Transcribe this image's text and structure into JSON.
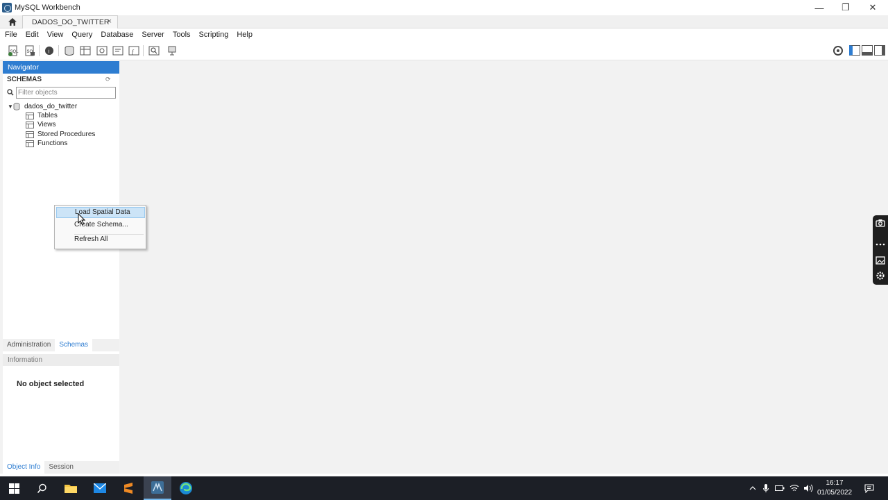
{
  "window": {
    "title": "MySQL Workbench",
    "minimize_glyph": "—",
    "maximize_glyph": "❐",
    "close_glyph": "✕"
  },
  "tabs": {
    "connection_tab_label": "DADOS_DO_TWITTER",
    "close_glyph": "×"
  },
  "menu": [
    "File",
    "Edit",
    "View",
    "Query",
    "Database",
    "Server",
    "Tools",
    "Scripting",
    "Help"
  ],
  "navigator": {
    "header": "Navigator",
    "schemas_label": "SCHEMAS",
    "filter_placeholder": "Filter objects",
    "schema_name": "dados_do_twitter",
    "expand_glyph": "▼",
    "children": [
      "Tables",
      "Views",
      "Stored Procedures",
      "Functions"
    ]
  },
  "sidebar_tabs": [
    "Administration",
    "Schemas"
  ],
  "info": {
    "header": "Information",
    "empty_text": "No object selected"
  },
  "bottom_tabs": [
    "Object Info",
    "Session"
  ],
  "context_menu": {
    "items": [
      "Load Spatial Data",
      "Create Schema...",
      "Refresh All"
    ]
  },
  "taskbar": {
    "time": "16:17",
    "date": "01/05/2022"
  },
  "colors": {
    "accent": "#2e7dd1",
    "taskbar": "#1c1f26",
    "workarea": "#f2f2f2"
  }
}
